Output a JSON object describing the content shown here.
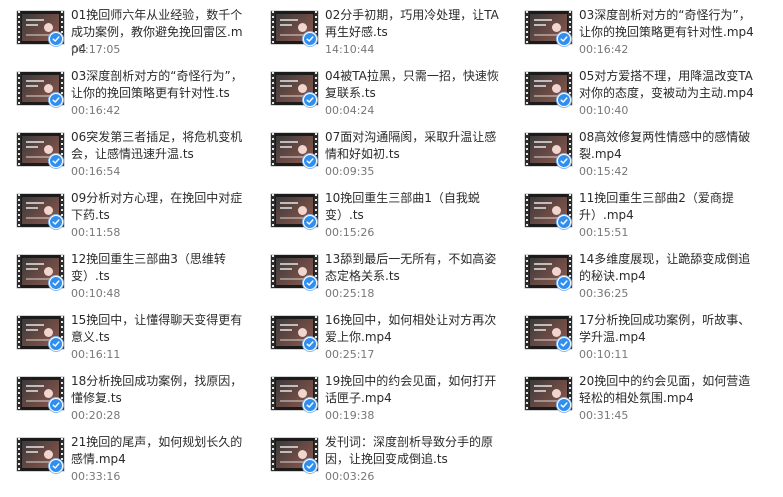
{
  "files": [
    {
      "name": "01挽回师六年从业经验，数千个成功案例，教你避免挽回雷区.mp4",
      "duration": "00:17:05"
    },
    {
      "name": "02分手初期，巧用冷处理，让TA再生好感.ts",
      "duration": "14:10:44"
    },
    {
      "name": "03深度剖析对方的“奇怪行为”，让你的挽回策略更有针对性.mp4",
      "duration": "00:16:42"
    },
    {
      "name": "03深度剖析对方的“奇怪行为”，让你的挽回策略更有针对性.ts",
      "duration": "00:16:42"
    },
    {
      "name": "04被TA拉黑，只需一招，快速恢复联系.ts",
      "duration": "00:04:24"
    },
    {
      "name": "05对方爱搭不理，用降温改变TA对你的态度，变被动为主动.mp4",
      "duration": "00:10:40"
    },
    {
      "name": "06突发第三者插足，将危机变机会，让感情迅速升温.ts",
      "duration": "00:16:54"
    },
    {
      "name": "07面对沟通隔阂，采取升温让感情和好如初.ts",
      "duration": "00:09:35"
    },
    {
      "name": "08高效修复两性情感中的感情破裂.mp4",
      "duration": "00:15:42"
    },
    {
      "name": "09分析对方心理，在挽回中对症下药.ts",
      "duration": "00:11:58"
    },
    {
      "name": "10挽回重生三部曲1（自我蜕变）.ts",
      "duration": "00:15:26"
    },
    {
      "name": "11挽回重生三部曲2（爱商提升）.mp4",
      "duration": "00:15:51"
    },
    {
      "name": "12挽回重生三部曲3（思维转变）.ts",
      "duration": "00:10:48"
    },
    {
      "name": "13舔到最后一无所有，不如高姿态定格关系.ts",
      "duration": "00:25:18"
    },
    {
      "name": "14多维度展现，让跪舔变成倒追的秘诀.mp4",
      "duration": "00:36:25"
    },
    {
      "name": "15挽回中，让懂得聊天变得更有意义.ts",
      "duration": "00:16:11"
    },
    {
      "name": "16挽回中，如何相处让对方再次爱上你.mp4",
      "duration": "00:25:17"
    },
    {
      "name": "17分析挽回成功案例，听故事、学升温.mp4",
      "duration": "00:10:11"
    },
    {
      "name": "18分析挽回成功案例，找原因，懂修复.ts",
      "duration": "00:20:28"
    },
    {
      "name": "19挽回中的约会见面，如何打开话匣子.mp4",
      "duration": "00:19:38"
    },
    {
      "name": "20挽回中的约会见面，如何营造轻松的相处氛围.mp4",
      "duration": "00:31:45"
    },
    {
      "name": "21挽回的尾声，如何规划长久的感情.mp4",
      "duration": "00:33:16"
    },
    {
      "name": "发刊词：深度剖析导致分手的原因，让挽回变成倒追.ts",
      "duration": "00:03:26"
    }
  ],
  "icons": {
    "thumbnail": "video-thumbnail-icon",
    "badge": "sync-check-icon"
  },
  "colors": {
    "badge": "#2f8ff0",
    "filename": "#2a2a2a",
    "duration": "#777777",
    "background": "#ffffff"
  }
}
